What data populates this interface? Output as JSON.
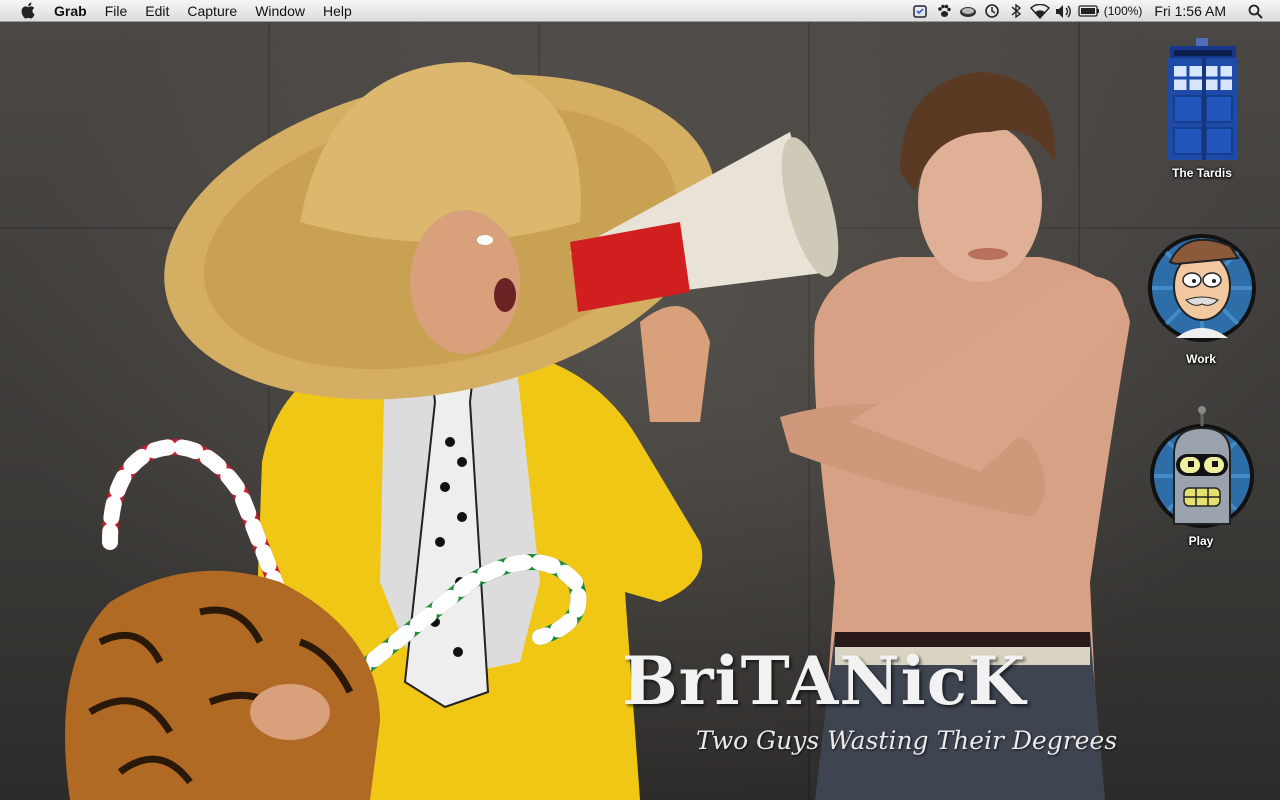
{
  "menubar": {
    "app_name": "Grab",
    "menus": [
      "File",
      "Edit",
      "Capture",
      "Window",
      "Help"
    ],
    "extras": [
      "alarm-clock-icon",
      "paw-icon",
      "eject-disc-icon",
      "time-machine-icon",
      "bluetooth-icon",
      "wifi-icon",
      "volume-icon",
      "battery-icon"
    ],
    "battery_percent": "(100%)",
    "clock": "Fri 1:56 AM"
  },
  "wallpaper": {
    "title": "BriTANicK",
    "subtitle": "Two Guys Wasting Their Degrees"
  },
  "desktop_icons": [
    {
      "label": "The Tardis",
      "icon": "tardis-icon"
    },
    {
      "label": "Work",
      "icon": "fry-face-icon"
    },
    {
      "label": "Play",
      "icon": "bender-face-icon"
    }
  ],
  "colors": {
    "menubar_bg": "#e8e8e8",
    "wall_bg": "#3c3a37",
    "yellow_suit": "#f1c715",
    "sombrero": "#d9b66a",
    "megaphone_red": "#d11f1f",
    "skin": "#d9a07c"
  }
}
